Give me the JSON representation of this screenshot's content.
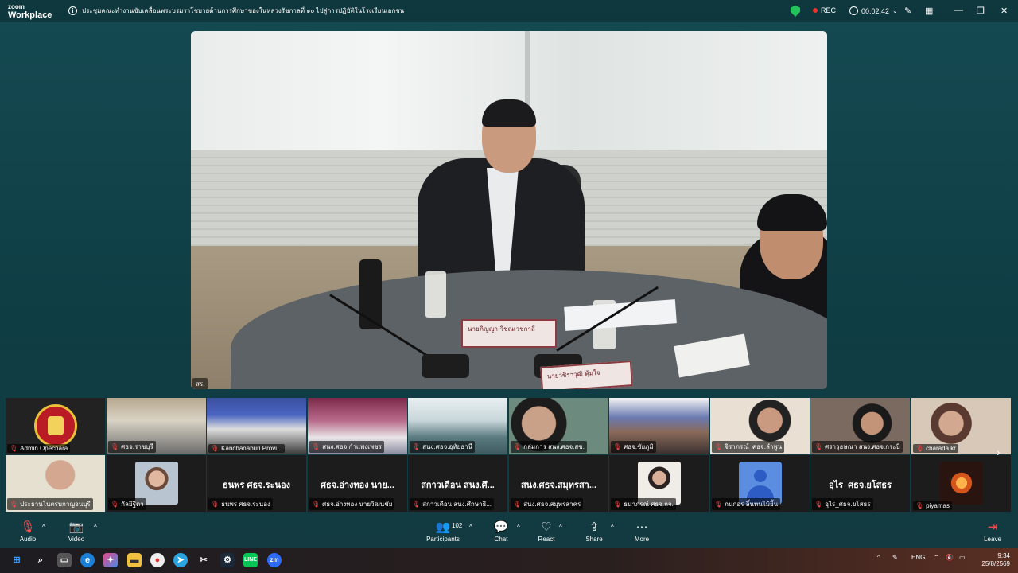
{
  "app": {
    "brand_small": "zoom",
    "brand_big": "Workplace",
    "meeting_title": "ประชุมคณะทำงานขับเคลื่อนพระบรมราโชบายด้านการศึกษาของในหลวงรัชกาลที่ ๑๐ ไปสู่การปฏิบัติในโรงเรียนเอกชน",
    "rec_label": "REC",
    "timer": "00:02:42"
  },
  "main_video": {
    "label": "สร.",
    "nameplate_1": "นายภิญญา วิชณเวชกาลี",
    "nameplate_2": "นายวชิราวุฒิ คุ้มใจ"
  },
  "gallery": {
    "tiles": [
      {
        "name": "Admin Opecnara",
        "center": ""
      },
      {
        "name": "ศธจ.ราชบุรี",
        "center": ""
      },
      {
        "name": "Kanchanaburi Provi...",
        "center": ""
      },
      {
        "name": "สนง.ศธจ.กำแพงเพชร",
        "center": ""
      },
      {
        "name": "สนง.ศธจ.อุทัยธานี",
        "center": ""
      },
      {
        "name": "กลุ่มการ สนง.ศธจ.สข.",
        "center": ""
      },
      {
        "name": "ศธจ.ชัยภูมิ",
        "center": ""
      },
      {
        "name": "จิราภรณ์_ศธจ.ลำพูน",
        "center": ""
      },
      {
        "name": "ศราวุธษณา สนง.ศธจ.กระบี่",
        "center": ""
      },
      {
        "name": "charada kr",
        "center": ""
      },
      {
        "name": "ประธานโนตรบกาญจนบุรี",
        "center": ""
      },
      {
        "name": "กัลยิฐิตา",
        "center": ""
      },
      {
        "name": "ธนพร ศธจ.ระนอง",
        "center": "ธนพร ศธจ.ระนอง"
      },
      {
        "name": "ศธจ.อ่างทอง นายวิฒนชัย",
        "center": "ศธจ.อ่างทอง นาย..."
      },
      {
        "name": "สกาวเดือน สนง.ศึกษาธิ...",
        "center": "สกาวเดือน สนง.ศึ..."
      },
      {
        "name": "สนง.ศธจ.สมุทรสาคร",
        "center": "สนง.ศธจ.สมุทรสา..."
      },
      {
        "name": "ธนาภรณ์ ศธจ.กจ.",
        "center": ""
      },
      {
        "name": "กนกอร ลิ้นทนไม้ยิ้น",
        "center": ""
      },
      {
        "name": "อุไร_ศธจ.ยโสธร",
        "center": "อุไร_ศธจ.ยโสธร"
      },
      {
        "name": "piyamas",
        "center": ""
      }
    ]
  },
  "toolbar": {
    "audio": "Audio",
    "video": "Video",
    "participants": "Participants",
    "participants_count": "102",
    "chat": "Chat",
    "react": "React",
    "share": "Share",
    "more": "More",
    "leave": "Leave"
  },
  "taskbar": {
    "lang": "ENG",
    "time": "9:34",
    "date": "25/8/2569"
  },
  "colors": {
    "background": "#154a52",
    "mute_red": "#ff4a4a",
    "rec_red": "#e8342f",
    "shield_green": "#24c25a"
  },
  "icons": [
    "info-icon",
    "shield-icon",
    "record-dot-icon",
    "clock-icon",
    "chevron-down-icon",
    "pen-icon",
    "grid-view-icon",
    "minimize-icon",
    "restore-icon",
    "close-icon",
    "microphone-muted-icon",
    "camera-muted-icon",
    "participants-icon",
    "chat-icon",
    "react-icon",
    "share-screen-icon",
    "more-icon",
    "leave-icon",
    "next-page-icon"
  ]
}
